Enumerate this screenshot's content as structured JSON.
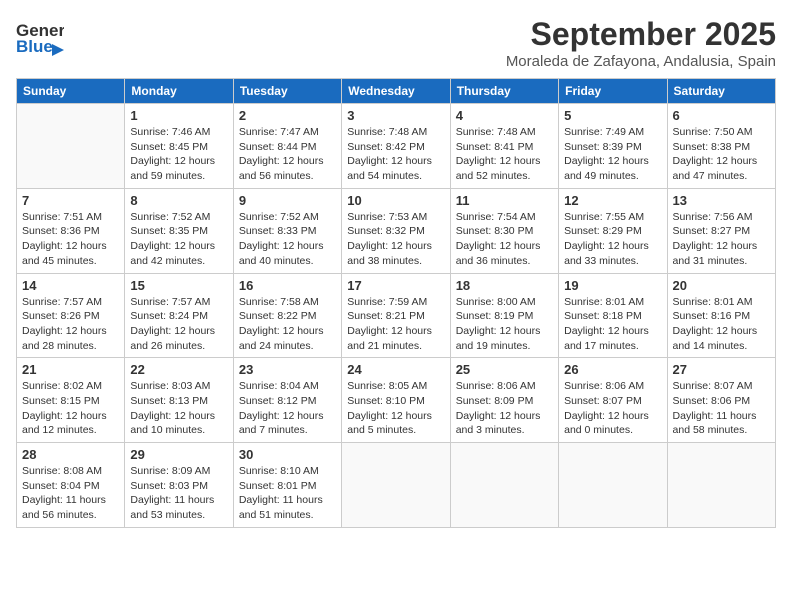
{
  "header": {
    "logo_general": "General",
    "logo_blue": "Blue",
    "month_title": "September 2025",
    "location": "Moraleda de Zafayona, Andalusia, Spain"
  },
  "calendar": {
    "days_of_week": [
      "Sunday",
      "Monday",
      "Tuesday",
      "Wednesday",
      "Thursday",
      "Friday",
      "Saturday"
    ],
    "weeks": [
      [
        {
          "day": "",
          "info": ""
        },
        {
          "day": "1",
          "info": "Sunrise: 7:46 AM\nSunset: 8:45 PM\nDaylight: 12 hours\nand 59 minutes."
        },
        {
          "day": "2",
          "info": "Sunrise: 7:47 AM\nSunset: 8:44 PM\nDaylight: 12 hours\nand 56 minutes."
        },
        {
          "day": "3",
          "info": "Sunrise: 7:48 AM\nSunset: 8:42 PM\nDaylight: 12 hours\nand 54 minutes."
        },
        {
          "day": "4",
          "info": "Sunrise: 7:48 AM\nSunset: 8:41 PM\nDaylight: 12 hours\nand 52 minutes."
        },
        {
          "day": "5",
          "info": "Sunrise: 7:49 AM\nSunset: 8:39 PM\nDaylight: 12 hours\nand 49 minutes."
        },
        {
          "day": "6",
          "info": "Sunrise: 7:50 AM\nSunset: 8:38 PM\nDaylight: 12 hours\nand 47 minutes."
        }
      ],
      [
        {
          "day": "7",
          "info": "Sunrise: 7:51 AM\nSunset: 8:36 PM\nDaylight: 12 hours\nand 45 minutes."
        },
        {
          "day": "8",
          "info": "Sunrise: 7:52 AM\nSunset: 8:35 PM\nDaylight: 12 hours\nand 42 minutes."
        },
        {
          "day": "9",
          "info": "Sunrise: 7:52 AM\nSunset: 8:33 PM\nDaylight: 12 hours\nand 40 minutes."
        },
        {
          "day": "10",
          "info": "Sunrise: 7:53 AM\nSunset: 8:32 PM\nDaylight: 12 hours\nand 38 minutes."
        },
        {
          "day": "11",
          "info": "Sunrise: 7:54 AM\nSunset: 8:30 PM\nDaylight: 12 hours\nand 36 minutes."
        },
        {
          "day": "12",
          "info": "Sunrise: 7:55 AM\nSunset: 8:29 PM\nDaylight: 12 hours\nand 33 minutes."
        },
        {
          "day": "13",
          "info": "Sunrise: 7:56 AM\nSunset: 8:27 PM\nDaylight: 12 hours\nand 31 minutes."
        }
      ],
      [
        {
          "day": "14",
          "info": "Sunrise: 7:57 AM\nSunset: 8:26 PM\nDaylight: 12 hours\nand 28 minutes."
        },
        {
          "day": "15",
          "info": "Sunrise: 7:57 AM\nSunset: 8:24 PM\nDaylight: 12 hours\nand 26 minutes."
        },
        {
          "day": "16",
          "info": "Sunrise: 7:58 AM\nSunset: 8:22 PM\nDaylight: 12 hours\nand 24 minutes."
        },
        {
          "day": "17",
          "info": "Sunrise: 7:59 AM\nSunset: 8:21 PM\nDaylight: 12 hours\nand 21 minutes."
        },
        {
          "day": "18",
          "info": "Sunrise: 8:00 AM\nSunset: 8:19 PM\nDaylight: 12 hours\nand 19 minutes."
        },
        {
          "day": "19",
          "info": "Sunrise: 8:01 AM\nSunset: 8:18 PM\nDaylight: 12 hours\nand 17 minutes."
        },
        {
          "day": "20",
          "info": "Sunrise: 8:01 AM\nSunset: 8:16 PM\nDaylight: 12 hours\nand 14 minutes."
        }
      ],
      [
        {
          "day": "21",
          "info": "Sunrise: 8:02 AM\nSunset: 8:15 PM\nDaylight: 12 hours\nand 12 minutes."
        },
        {
          "day": "22",
          "info": "Sunrise: 8:03 AM\nSunset: 8:13 PM\nDaylight: 12 hours\nand 10 minutes."
        },
        {
          "day": "23",
          "info": "Sunrise: 8:04 AM\nSunset: 8:12 PM\nDaylight: 12 hours\nand 7 minutes."
        },
        {
          "day": "24",
          "info": "Sunrise: 8:05 AM\nSunset: 8:10 PM\nDaylight: 12 hours\nand 5 minutes."
        },
        {
          "day": "25",
          "info": "Sunrise: 8:06 AM\nSunset: 8:09 PM\nDaylight: 12 hours\nand 3 minutes."
        },
        {
          "day": "26",
          "info": "Sunrise: 8:06 AM\nSunset: 8:07 PM\nDaylight: 12 hours\nand 0 minutes."
        },
        {
          "day": "27",
          "info": "Sunrise: 8:07 AM\nSunset: 8:06 PM\nDaylight: 11 hours\nand 58 minutes."
        }
      ],
      [
        {
          "day": "28",
          "info": "Sunrise: 8:08 AM\nSunset: 8:04 PM\nDaylight: 11 hours\nand 56 minutes."
        },
        {
          "day": "29",
          "info": "Sunrise: 8:09 AM\nSunset: 8:03 PM\nDaylight: 11 hours\nand 53 minutes."
        },
        {
          "day": "30",
          "info": "Sunrise: 8:10 AM\nSunset: 8:01 PM\nDaylight: 11 hours\nand 51 minutes."
        },
        {
          "day": "",
          "info": ""
        },
        {
          "day": "",
          "info": ""
        },
        {
          "day": "",
          "info": ""
        },
        {
          "day": "",
          "info": ""
        }
      ]
    ]
  }
}
